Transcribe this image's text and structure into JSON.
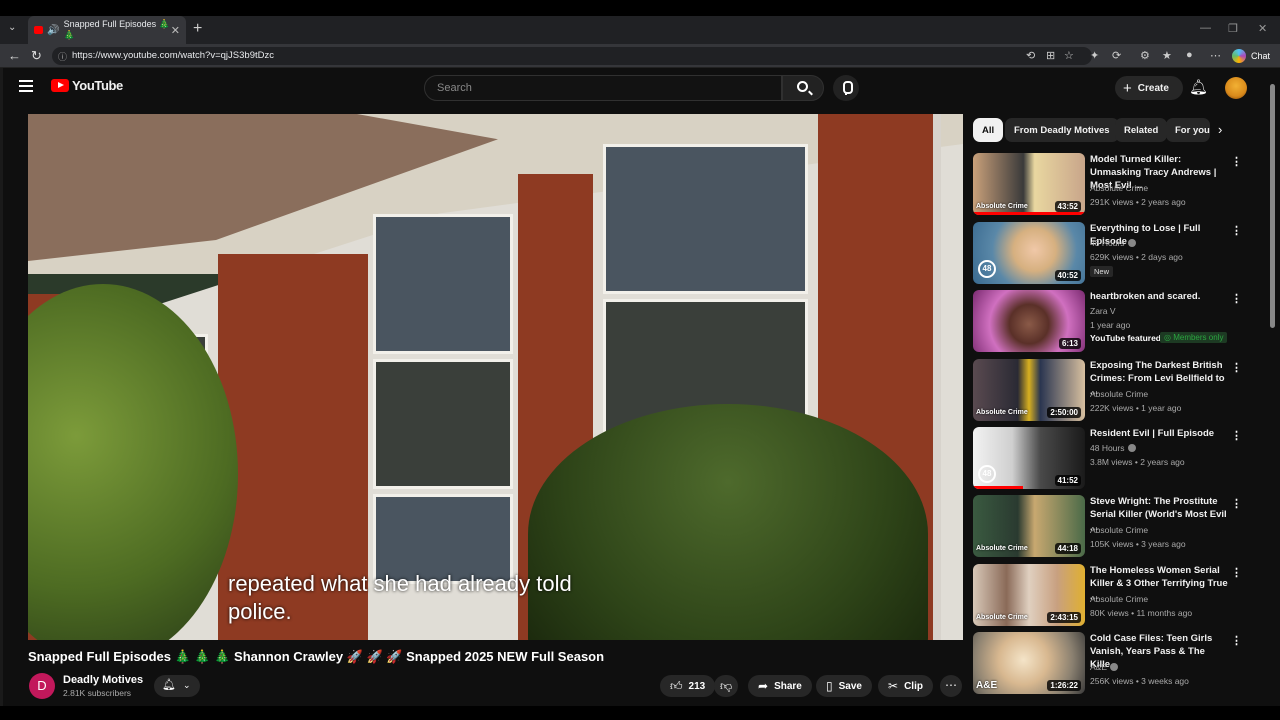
{
  "browser": {
    "tab_title": "Snapped Full Episodes 🎄🎄",
    "url": "https://www.youtube.com/watch?v=qjJS3b9tDzc",
    "chat_label": "Chat"
  },
  "header": {
    "logo_text": "YouTube",
    "search_placeholder": "Search",
    "create_label": "Create"
  },
  "player": {
    "caption_line1": "repeated what she had already told",
    "caption_line2": "police."
  },
  "video": {
    "title": "Snapped Full Episodes 🎄 🎄 🎄 Shannon Crawley 🚀 🚀 🚀 Snapped 2025 NEW Full Season",
    "channel_avatar_letter": "D",
    "channel_name": "Deadly Motives",
    "subscribers": "2.81K subscribers",
    "likes": "213",
    "share_label": "Share",
    "save_label": "Save",
    "clip_label": "Clip"
  },
  "chips": [
    "All",
    "From Deadly Motives",
    "Related",
    "For you"
  ],
  "recommendations": [
    {
      "title": "Model Turned Killer: Unmasking Tracy Andrews | Most Evil ...",
      "channel": "Absolute Crime",
      "meta": "291K views • 2 years ago",
      "duration": "43:52",
      "overlay": "Absolute Crime",
      "progress": 1.0
    },
    {
      "title": "Everything to Lose | Full Episode",
      "channel": "48 Hours",
      "meta": "629K views • 2 days ago",
      "duration": "40:52",
      "badge": "New",
      "overlay": "48",
      "progress": 0
    },
    {
      "title": "heartbroken and scared.",
      "channel": "Zara V",
      "meta": "1 year ago",
      "duration": "6:13",
      "featured": "YouTube featured",
      "members": "Members only",
      "progress": 0
    },
    {
      "title": "Exposing The Darkest British Crimes: From Levi Bellfield to ...",
      "channel": "Absolute Crime",
      "meta": "222K views • 1 year ago",
      "duration": "2:50:00",
      "overlay": "Absolute Crime",
      "progress": 0
    },
    {
      "title": "Resident Evil | Full Episode",
      "channel": "48 Hours",
      "meta": "3.8M views • 2 years ago",
      "duration": "41:52",
      "overlay": "48",
      "progress": 0.45
    },
    {
      "title": "Steve Wright: The Prostitute Serial Killer (World's Most Evil ...",
      "channel": "Absolute Crime",
      "meta": "105K views • 3 years ago",
      "duration": "44:18",
      "overlay": "Absolute Crime",
      "progress": 0
    },
    {
      "title": "The Homeless Women Serial Killer & 3 Other Terrifying True ...",
      "channel": "Absolute Crime",
      "meta": "80K views • 11 months ago",
      "duration": "2:43:15",
      "overlay": "Absolute Crime",
      "progress": 0
    },
    {
      "title": "Cold Case Files: Teen Girls Vanish, Years Pass & The Kille...",
      "channel": "A&E",
      "meta": "256K views • 3 weeks ago",
      "duration": "1:26:22",
      "overlay": "A&E",
      "progress": 0
    }
  ],
  "colors": {
    "accent": "#ff0000",
    "background": "#0f0f0f",
    "members_green": "#2ba640"
  }
}
